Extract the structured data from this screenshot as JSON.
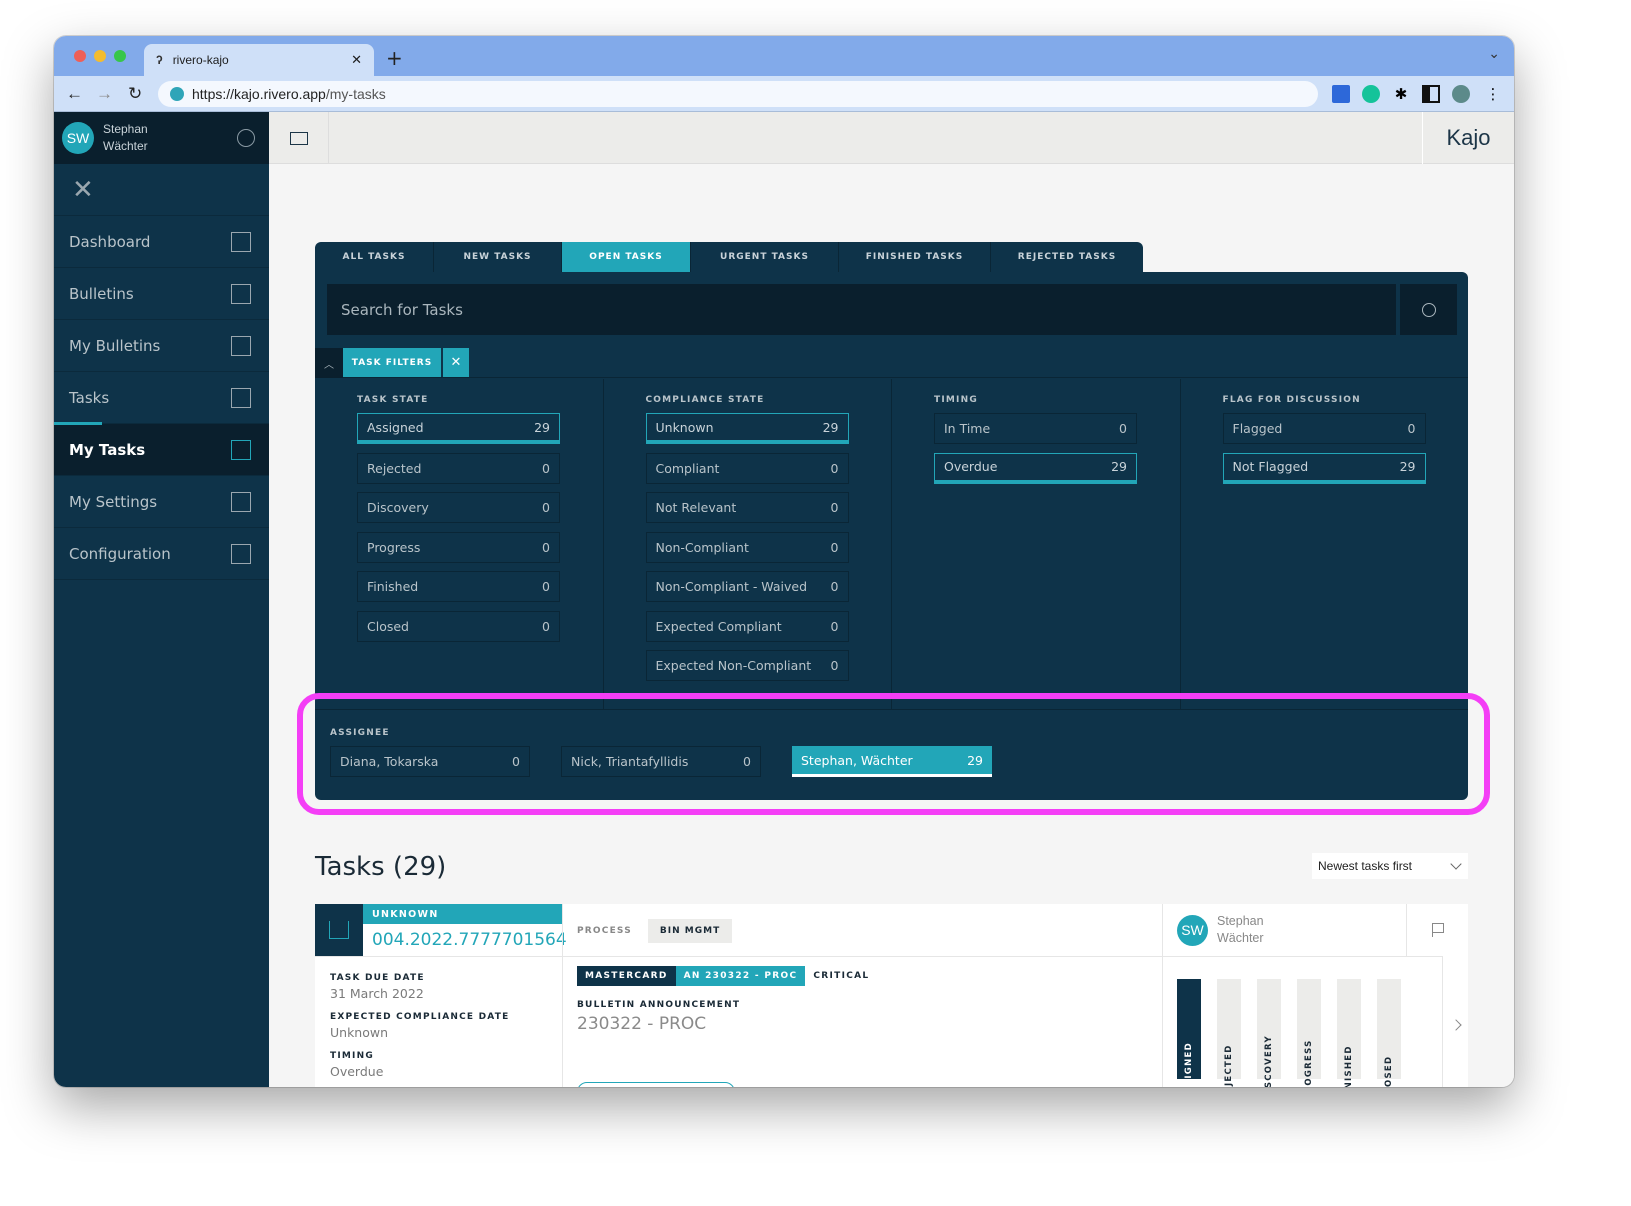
{
  "browser": {
    "tab_title": "rivero-kajo",
    "url_host": "https://kajo.rivero.app",
    "url_path": "/my-tasks"
  },
  "user": {
    "initials": "SW",
    "first": "Stephan",
    "last": "Wächter"
  },
  "brand": "Kajo",
  "sidebar": {
    "items": [
      {
        "label": "Dashboard",
        "icon": "dashboard-icon"
      },
      {
        "label": "Bulletins",
        "icon": "bulletin-icon"
      },
      {
        "label": "My Bulletins",
        "icon": "my-bulletins-icon"
      },
      {
        "label": "Tasks",
        "icon": "tasks-icon"
      },
      {
        "label": "My Tasks",
        "icon": "my-tasks-icon",
        "active": true
      },
      {
        "label": "My Settings",
        "icon": "sliders-icon"
      },
      {
        "label": "Configuration",
        "icon": "home-icon"
      }
    ]
  },
  "tabs": [
    "ALL TASKS",
    "NEW TASKS",
    "OPEN TASKS",
    "URGENT TASKS",
    "FINISHED TASKS",
    "REJECTED TASKS"
  ],
  "active_tab": "OPEN TASKS",
  "search": {
    "placeholder": "Search for Tasks"
  },
  "filters": {
    "chip": "TASK FILTERS",
    "task_state": {
      "title": "TASK STATE",
      "items": [
        {
          "label": "Assigned",
          "count": "29",
          "selected": true
        },
        {
          "label": "Rejected",
          "count": "0"
        },
        {
          "label": "Discovery",
          "count": "0"
        },
        {
          "label": "Progress",
          "count": "0"
        },
        {
          "label": "Finished",
          "count": "0"
        },
        {
          "label": "Closed",
          "count": "0"
        }
      ]
    },
    "compliance_state": {
      "title": "COMPLIANCE STATE",
      "items": [
        {
          "label": "Unknown",
          "count": "29",
          "selected": true
        },
        {
          "label": "Compliant",
          "count": "0"
        },
        {
          "label": "Not Relevant",
          "count": "0"
        },
        {
          "label": "Non-Compliant",
          "count": "0"
        },
        {
          "label": "Non-Compliant - Waived",
          "count": "0"
        },
        {
          "label": "Expected Compliant",
          "count": "0"
        },
        {
          "label": "Expected Non-Compliant",
          "count": "0"
        }
      ]
    },
    "timing": {
      "title": "TIMING",
      "items": [
        {
          "label": "In Time",
          "count": "0"
        },
        {
          "label": "Overdue",
          "count": "29",
          "selected": true
        }
      ]
    },
    "flag": {
      "title": "FLAG FOR DISCUSSION",
      "items": [
        {
          "label": "Flagged",
          "count": "0"
        },
        {
          "label": "Not Flagged",
          "count": "29",
          "selected": true
        }
      ]
    },
    "assignee": {
      "title": "ASSIGNEE",
      "items": [
        {
          "label": "Diana, Tokarska",
          "count": "0"
        },
        {
          "label": "Nick, Triantafyllidis",
          "count": "0"
        },
        {
          "label": "Stephan, Wächter",
          "count": "29",
          "selected": true
        }
      ]
    }
  },
  "tasks": {
    "heading": "Tasks (29)",
    "sort": "Newest tasks first",
    "card": {
      "state": "UNKNOWN",
      "id": "004.2022.7777701564",
      "due_label": "TASK DUE DATE",
      "due_value": "31 March 2022",
      "exp_label": "EXPECTED COMPLIANCE DATE",
      "exp_value": "Unknown",
      "timing_label": "TIMING",
      "timing_value": "Overdue",
      "process_label": "PROCESS",
      "process_value": "BIN MGMT",
      "tags": [
        "MASTERCARD",
        "AN 230322 - PROC",
        "CRITICAL"
      ],
      "bulletin_label": "BULLETIN ANNOUNCEMENT",
      "bulletin_value": "230322 - PROC",
      "assignee_initials": "SW",
      "assignee_first": "Stephan",
      "assignee_last": "Wächter",
      "steps": [
        "ASSIGNED",
        "REJECTED",
        "DISCOVERY",
        "PROGRESS",
        "FINISHED",
        "CLOSED"
      ],
      "active_step": "ASSIGNED"
    }
  },
  "colors": {
    "accent": "#22a6b8",
    "navy": "#0e3349",
    "dark": "#0a1f2d",
    "highlight": "#f43ef6"
  }
}
